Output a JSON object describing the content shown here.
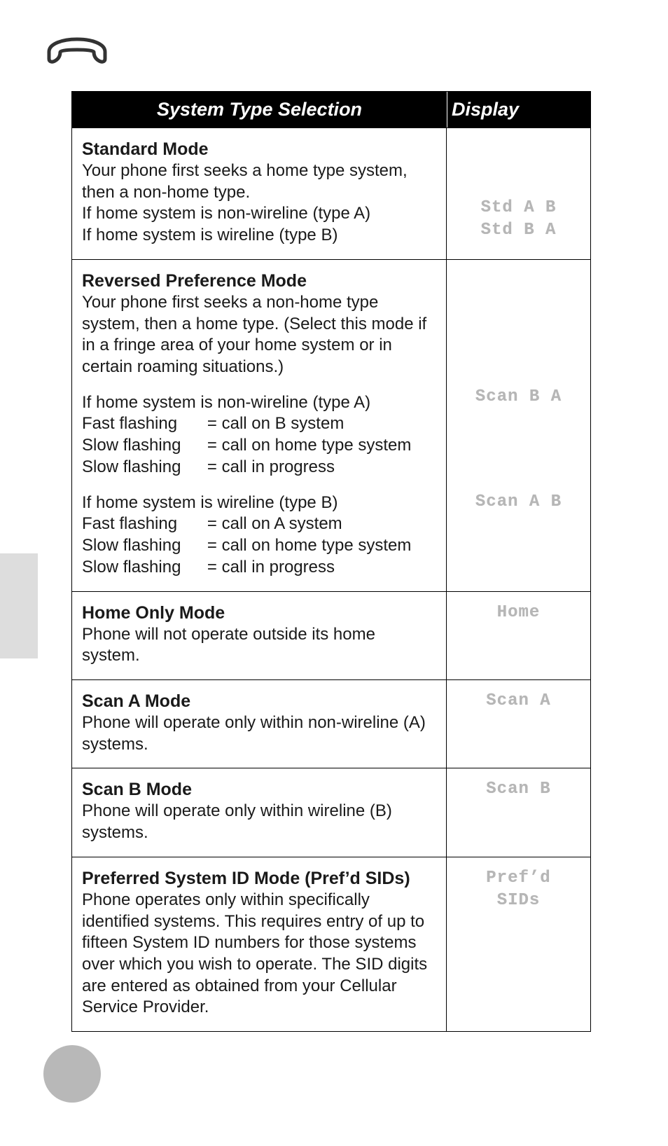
{
  "header": {
    "col1": "System Type Selection",
    "col2": "Display"
  },
  "rows": {
    "standard": {
      "title": "Standard Mode",
      "body1": "Your phone first seeks a home type system, then a non-home type.",
      "lineA": "If home system is non-wireline (type A)",
      "lineB": "If home system is wireline (type B)",
      "disp1": "Std A B",
      "disp2": "Std B A"
    },
    "reversed": {
      "title": "Reversed Preference Mode",
      "body1": "Your phone first seeks a non-home type system, then a home type. (Select this mode if in a fringe area of your home system or in certain roaming situations.)",
      "secA_head": "If home system is non-wireline (type A)",
      "secA_r1_l": "Fast flashing",
      "secA_r1_r": "= call on B system",
      "secA_r2_l": "Slow flashing",
      "secA_r2_r": "= call on home type system",
      "secA_r3_l": "Slow flashing",
      "secA_r3_r": "= call in progress",
      "secB_head": "If home system is wireline (type B)",
      "secB_r1_l": "Fast flashing",
      "secB_r1_r": "= call on A system",
      "secB_r2_l": "Slow flashing",
      "secB_r2_r": "= call on home type system",
      "secB_r3_l": "Slow flashing",
      "secB_r3_r": "= call in progress",
      "dispA": "Scan B A",
      "dispB": "Scan A B"
    },
    "homeonly": {
      "title": "Home Only Mode",
      "body": "Phone will not operate outside its home system.",
      "disp": "Home"
    },
    "scana": {
      "title": "Scan A Mode",
      "body": "Phone will operate only within non-wireline (A) systems.",
      "disp": "Scan A"
    },
    "scanb": {
      "title": "Scan B Mode",
      "body": "Phone will operate only within wireline (B) systems.",
      "disp": "Scan B"
    },
    "prefd": {
      "title": "Preferred System ID Mode (Pref’d SIDs)",
      "body": "Phone operates only within specifically identified systems.  This requires entry of up to fifteen System ID numbers for those systems over which you wish to operate.  The SID digits are entered as obtained from your Cellular Service Provider.",
      "disp1": "Pref’d",
      "disp2": "SIDs"
    }
  }
}
